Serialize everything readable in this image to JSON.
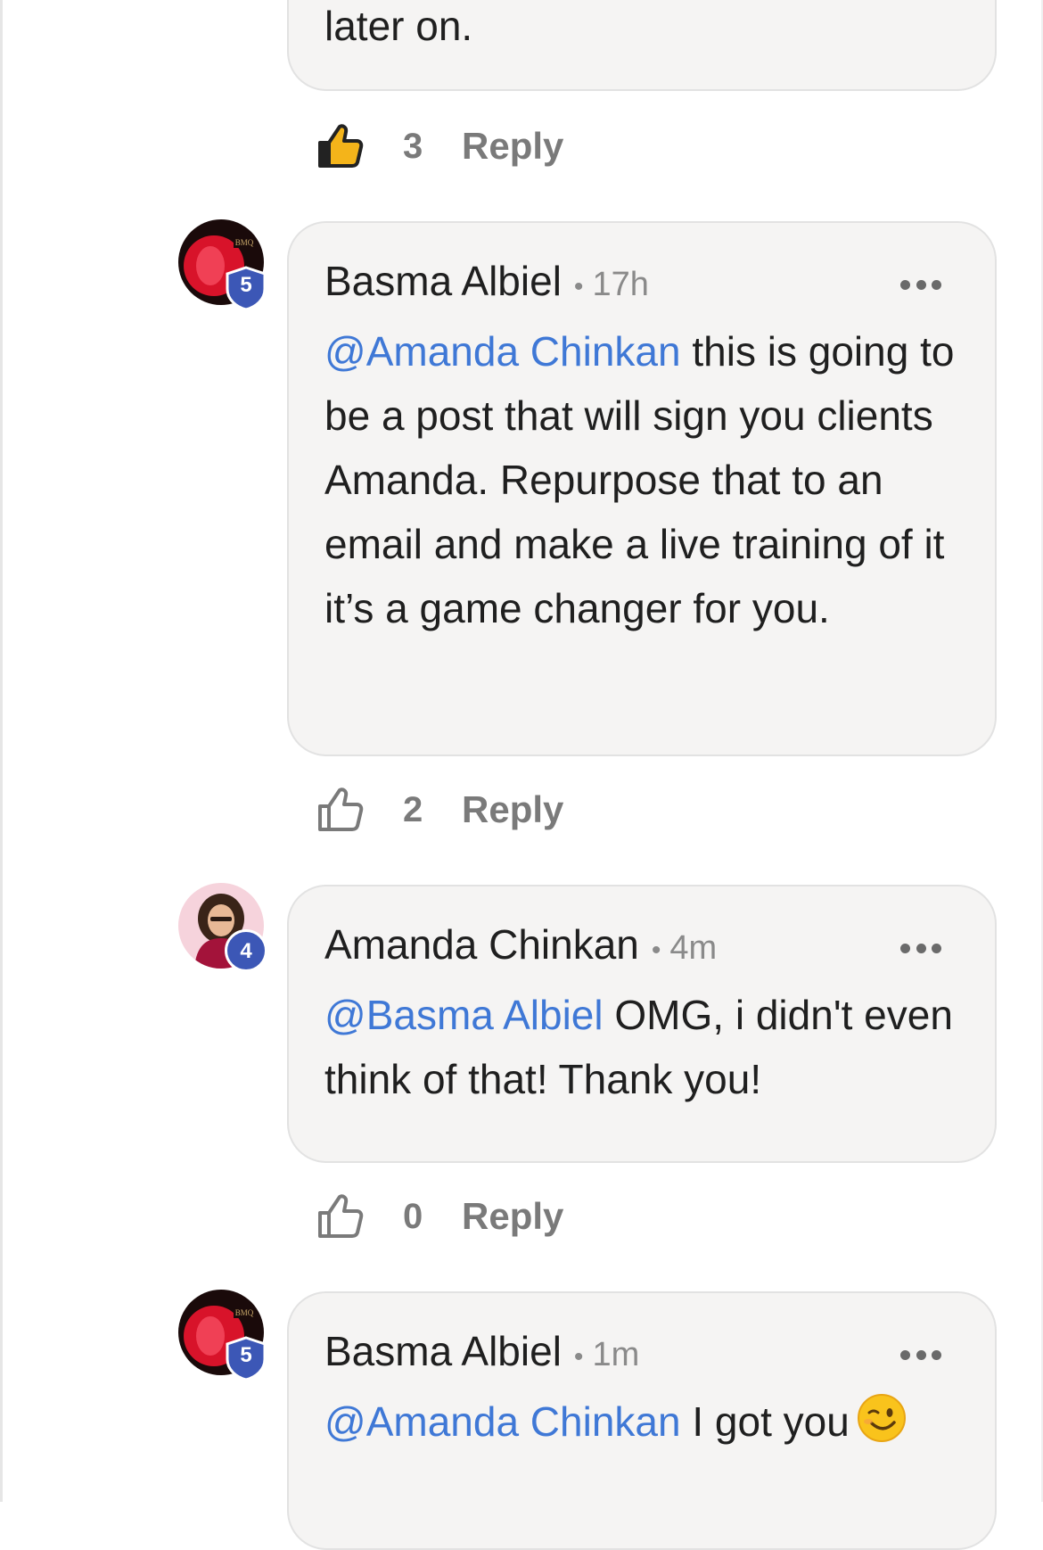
{
  "comments": [
    {
      "partial_text": "later on.",
      "likes": "3",
      "liked": true,
      "reply_label": "Reply"
    },
    {
      "author": "Basma Albiel",
      "dot": "•",
      "time": "17h",
      "level": "5",
      "mention": "@Amanda Chinkan",
      "text": " this is going to be a post that will sign you clients Amanda. Repurpose that to an email and make a live training of it it’s a game changer for you.",
      "likes": "2",
      "reply_label": "Reply"
    },
    {
      "author": "Amanda Chinkan",
      "dot": "•",
      "time": "4m",
      "level": "4",
      "mention": "@Basma Albiel",
      "text": " OMG, i didn't even think of that! Thank you!",
      "likes": "0",
      "reply_label": "Reply"
    },
    {
      "author": "Basma Albiel",
      "dot": "•",
      "time": "1m",
      "level": "5",
      "mention": "@Amanda Chinkan",
      "text": " I got you",
      "emoji": "winking-face-emoji"
    }
  ],
  "icons": {
    "like": "thumbs-up-icon",
    "more": "more-options-icon"
  },
  "colors": {
    "mention": "#3f78d6",
    "level_badge": "#3c57b6",
    "bubble": "#f5f4f3"
  }
}
